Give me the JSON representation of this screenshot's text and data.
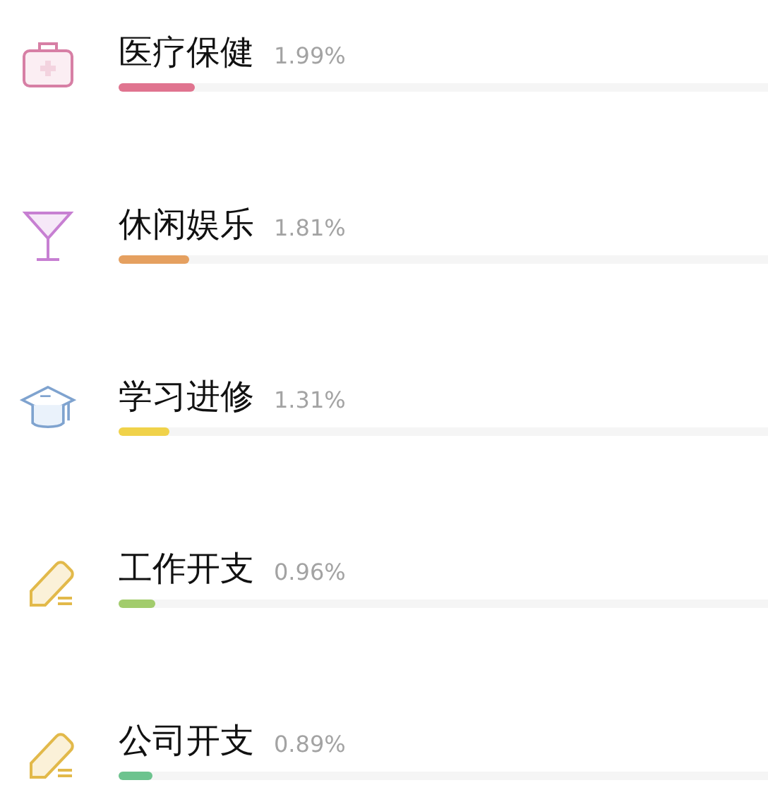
{
  "categories": [
    {
      "kind": "medkit",
      "name": "医疗保健",
      "percent": "1.99%",
      "level": 0.117,
      "color": "#e0748f"
    },
    {
      "kind": "glass",
      "name": "休闲娱乐",
      "percent": "1.81%",
      "level": 0.109,
      "color": "#e5a060"
    },
    {
      "kind": "cap",
      "name": "学习进修",
      "percent": "1.31%",
      "level": 0.078,
      "color": "#f0d24a"
    },
    {
      "kind": "pencil",
      "name": "工作开支",
      "percent": "0.96%",
      "level": 0.057,
      "color": "#a2cc6c"
    },
    {
      "kind": "pencil",
      "name": "公司开支",
      "percent": "0.89%",
      "level": 0.052,
      "color": "#6cc38e"
    }
  ]
}
